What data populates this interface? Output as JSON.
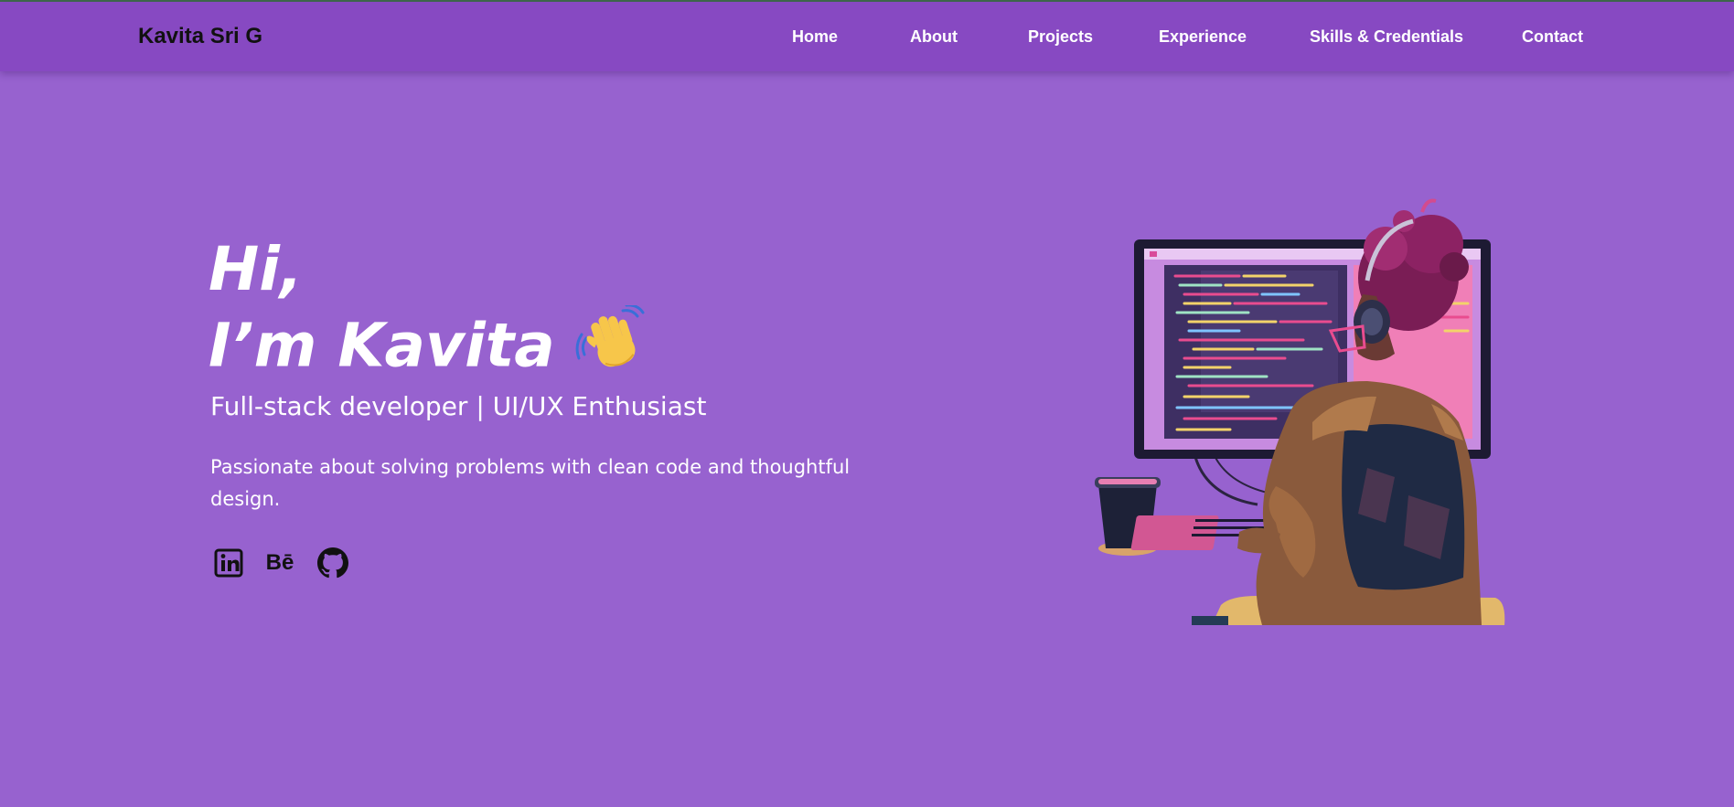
{
  "header": {
    "brand": "Kavita Sri G",
    "nav": [
      {
        "label": "Home"
      },
      {
        "label": "About"
      },
      {
        "label": "Projects"
      },
      {
        "label": "Experience"
      },
      {
        "label": "Skills & Credentials"
      },
      {
        "label": "Contact"
      }
    ]
  },
  "hero": {
    "greeting_line1": "Hi,",
    "greeting_line2": "I’m Kavita",
    "subtitle": "Full-stack developer | UI/UX Enthusiast",
    "description": "Passionate about solving problems with clean code and thoughtful design.",
    "socials": [
      {
        "icon": "linkedin-icon"
      },
      {
        "icon": "behance-icon",
        "text": "Bē"
      },
      {
        "icon": "github-icon"
      }
    ],
    "illustration": "developer-at-computer-illustration"
  },
  "colors": {
    "background": "#9762cf",
    "navbar": "#8749c2",
    "text": "#ffffff",
    "brand_text": "#111111"
  }
}
